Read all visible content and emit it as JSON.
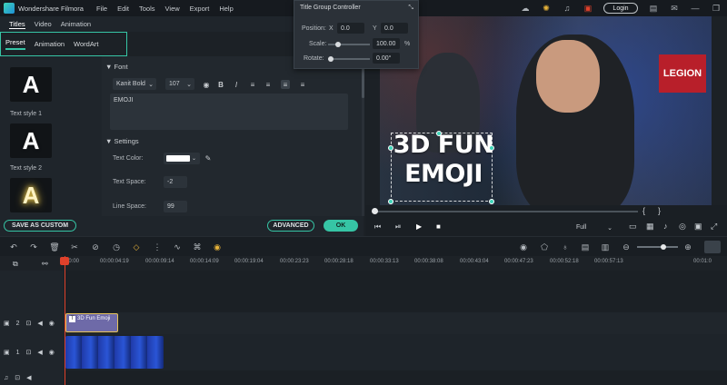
{
  "titlebar": {
    "app_name": "Wondershare Filmora",
    "menu": [
      "File",
      "Edit",
      "Tools",
      "View",
      "Export",
      "Help"
    ],
    "login_label": "Login"
  },
  "top_tabs": [
    "Titles",
    "Video",
    "Animation"
  ],
  "sub_tabs": [
    "Preset",
    "Animation",
    "WordArt"
  ],
  "presets": [
    {
      "glyph": "A",
      "label": "Text style 1"
    },
    {
      "glyph": "A",
      "label": "Text style 2"
    },
    {
      "glyph": "A",
      "label": ""
    }
  ],
  "font": {
    "section": "Font",
    "family": "Kanit Bold",
    "size": "107",
    "text_value": "EMOJI",
    "format_buttons": [
      "B",
      "I"
    ]
  },
  "settings": {
    "section": "Settings",
    "text_color_label": "Text Color:",
    "text_color": "#ffffff",
    "text_space_label": "Text Space:",
    "text_space_value": "-2",
    "line_space_label": "Line Space:",
    "line_space_value": "99"
  },
  "buttons": {
    "save_custom": "SAVE AS CUSTOM",
    "advanced": "ADVANCED",
    "ok": "OK"
  },
  "title_group_controller": {
    "title": "Title Group Controller",
    "position_label": "Position:",
    "x_label": "X",
    "x_value": "0.0",
    "y_label": "Y",
    "y_value": "0.0",
    "scale_label": "Scale:",
    "scale_value": "100.00",
    "scale_unit": "%",
    "rotate_label": "Rotate:",
    "rotate_value": "0.00°"
  },
  "preview": {
    "overlay_line1": "3D FUN",
    "overlay_line2": "EMOJI",
    "brand_text": "LEGION",
    "quality": "Full",
    "bracket_open": "{",
    "bracket_close": "}"
  },
  "ruler": {
    "ticks": [
      "00:00",
      "00:00:04:19",
      "00:00:09:14",
      "00:00:14:09",
      "00:00:19:04",
      "00:00:23:23",
      "00:00:28:18",
      "00:00:33:13",
      "00:00:38:08",
      "00:00:43:04",
      "00:00:47:23",
      "00:00:52:18",
      "00:00:57:13",
      "00:01:0"
    ]
  },
  "tracks": {
    "title_clip": "3D Fun Emoji",
    "track2_num": "2",
    "track1_num": "1"
  },
  "colors": {
    "accent": "#36c5a5",
    "playhead": "#e0412b",
    "title_clip": "#6e6aa8"
  }
}
